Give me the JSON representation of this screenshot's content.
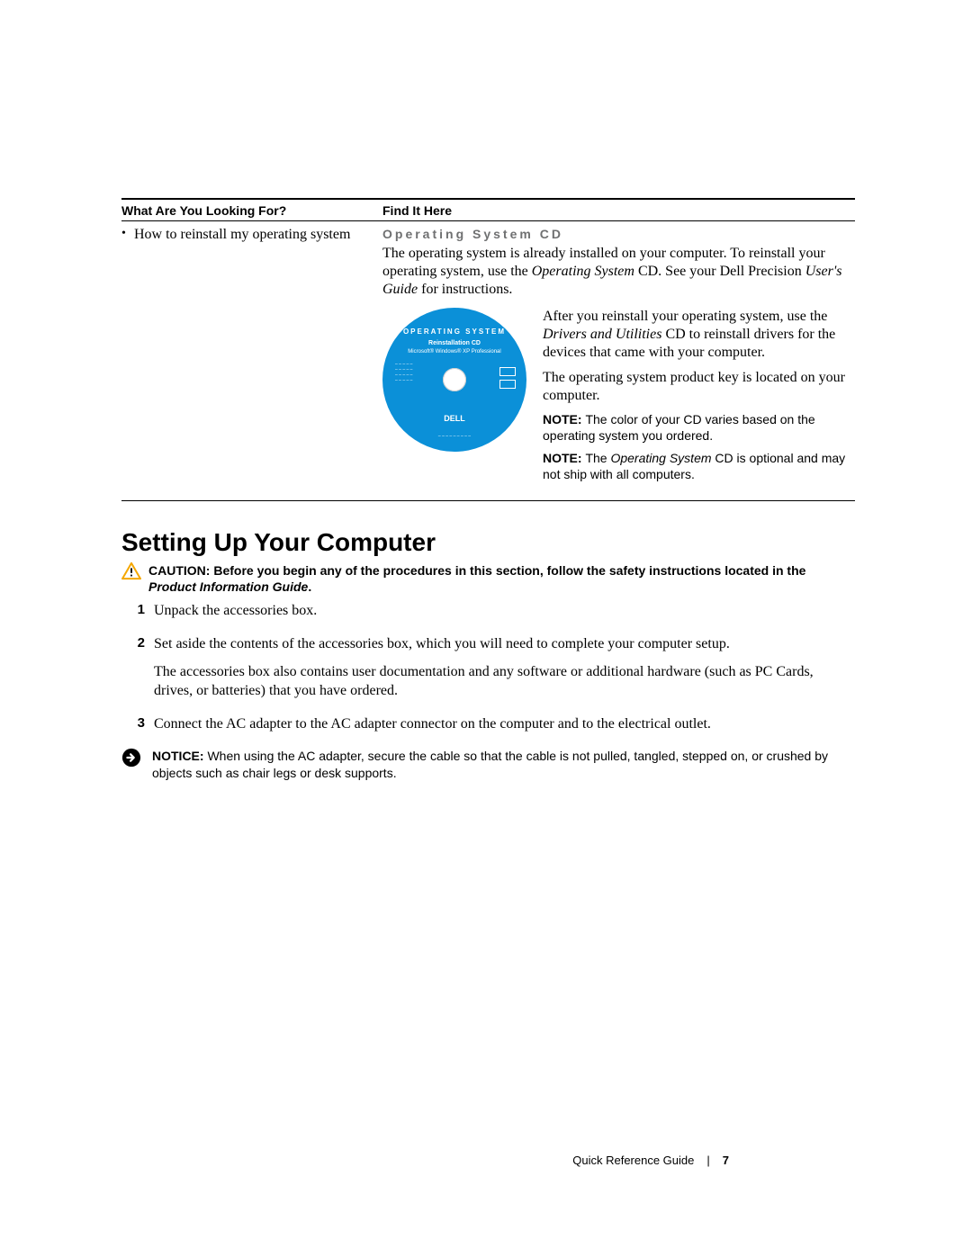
{
  "table": {
    "headers": {
      "left": "What Are You Looking For?",
      "right": "Find It Here"
    },
    "rows": [
      {
        "bullet": "How to reinstall my operating system",
        "sectionTitle": "Operating System CD",
        "para1_a": "The operating system is already installed on your computer. To reinstall your operating system, use the ",
        "para1_i1": "Operating System",
        "para1_b": " CD. See your Dell Precision ",
        "para1_i2": "User's Guide",
        "para1_c": " for instructions.",
        "side_p1_a": "After you reinstall your operating system, use the ",
        "side_p1_i": "Drivers and Utilities",
        "side_p1_b": " CD to reinstall drivers for the devices that came with your computer.",
        "side_p2": "The operating system product key is located on your computer.",
        "note1_lbl": "NOTE: ",
        "note1_txt": "The color of your CD varies based on the operating system you ordered.",
        "note2_lbl": "NOTE: ",
        "note2_a": "The ",
        "note2_i": "Operating System",
        "note2_b": " CD is optional and may not ship with all computers."
      }
    ]
  },
  "cd": {
    "title": "OPERATING SYSTEM",
    "sub": "Reinstallation CD",
    "sub2": "Microsoft® Windows® XP Professional",
    "brand": "DELL"
  },
  "heading": "Setting Up Your Computer",
  "caution": {
    "label": "CAUTION: ",
    "text_a": "Before you begin any of the procedures in this section, follow the safety instructions located in the ",
    "text_i": "Product Information Guide",
    "text_b": "."
  },
  "steps": [
    {
      "num": "1",
      "paras": [
        "Unpack the accessories box."
      ]
    },
    {
      "num": "2",
      "paras": [
        "Set aside the contents of the accessories box, which you will need to complete your computer setup.",
        "The accessories box also contains user documentation and any software or additional hardware (such as PC Cards, drives, or batteries) that you have ordered."
      ]
    },
    {
      "num": "3",
      "paras": [
        "Connect the AC adapter to the AC adapter connector on the computer and to the electrical outlet."
      ]
    }
  ],
  "notice": {
    "label": "NOTICE: ",
    "text": "When using the AC adapter, secure the cable so that the cable is not pulled, tangled, stepped on, or crushed by objects such as chair legs or desk supports."
  },
  "footer": {
    "title": "Quick Reference Guide",
    "page": "7"
  }
}
